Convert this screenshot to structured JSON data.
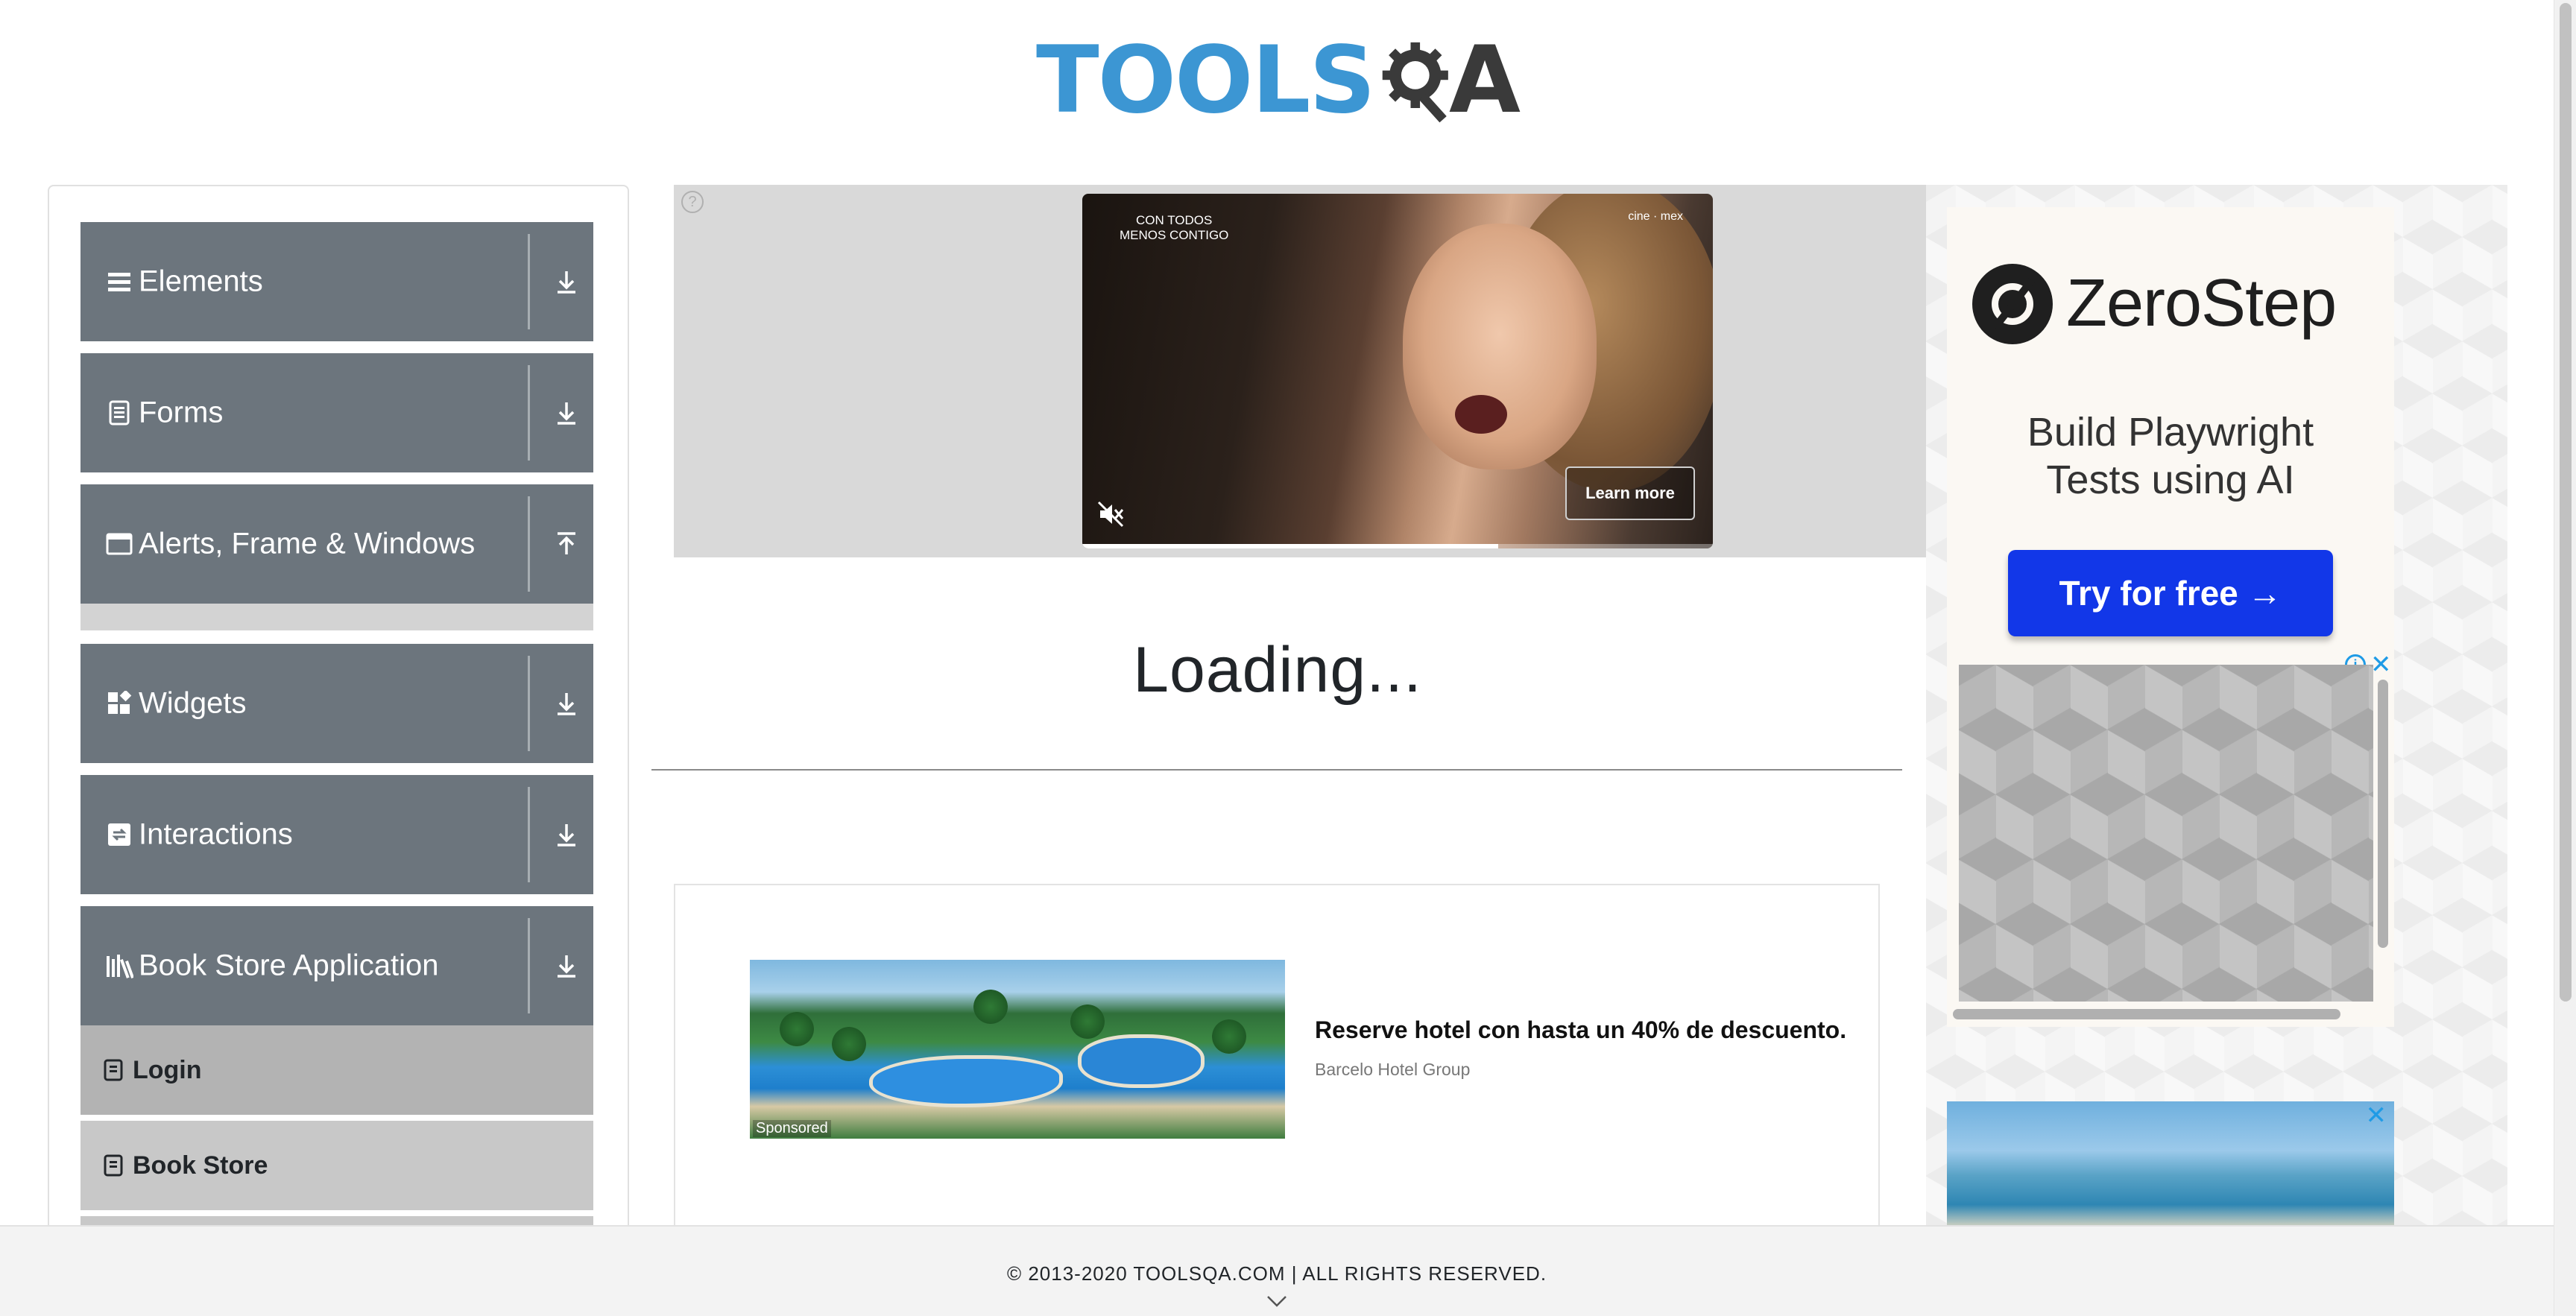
{
  "header": {
    "logo_text": "TOOLS",
    "logo_suffix": "A",
    "logo_alt": "TOOLSQA"
  },
  "sidebar": {
    "groups": [
      {
        "label": "Elements",
        "icon": "hamburger-icon",
        "expanded": false
      },
      {
        "label": "Forms",
        "icon": "document-icon",
        "expanded": false
      },
      {
        "label": "Alerts, Frame & Windows",
        "icon": "window-icon",
        "expanded": false
      },
      {
        "label": "Widgets",
        "icon": "widgets-icon",
        "expanded": false
      },
      {
        "label": "Interactions",
        "icon": "interactions-icon",
        "expanded": false
      },
      {
        "label": "Book Store Application",
        "icon": "books-icon",
        "expanded": true
      }
    ],
    "book_store_items": [
      {
        "label": "Login",
        "icon": "book-icon",
        "active": true
      },
      {
        "label": "Book Store",
        "icon": "book-icon",
        "active": false
      }
    ]
  },
  "video_ad": {
    "brand_text": "CON TODOS\nMENOS CONTIGO",
    "brand_right": "cine · mex",
    "learn_more": "Learn more",
    "progress": 0.66
  },
  "main": {
    "loading_text": "Loading..."
  },
  "native_ad": {
    "sponsored": "Sponsored",
    "title": "Reserve hotel con hasta un 40% de descuento.",
    "source": "Barcelo Hotel Group"
  },
  "right_ad": {
    "brand": "ZeroStep",
    "headline_1": "Build Playwright",
    "headline_2": "Tests using AI",
    "cta": "Try for free →",
    "ad_choices": "i",
    "close": "✕"
  },
  "footer": {
    "copyright": "© 2013-2020 TOOLSQA.COM | ALL RIGHTS RESERVED."
  },
  "colors": {
    "sidebar_group_bg": "#6c757d",
    "logo_blue": "#3c96d3",
    "cta_blue": "#1237e8",
    "ad_icon_blue": "#1f9be6"
  }
}
